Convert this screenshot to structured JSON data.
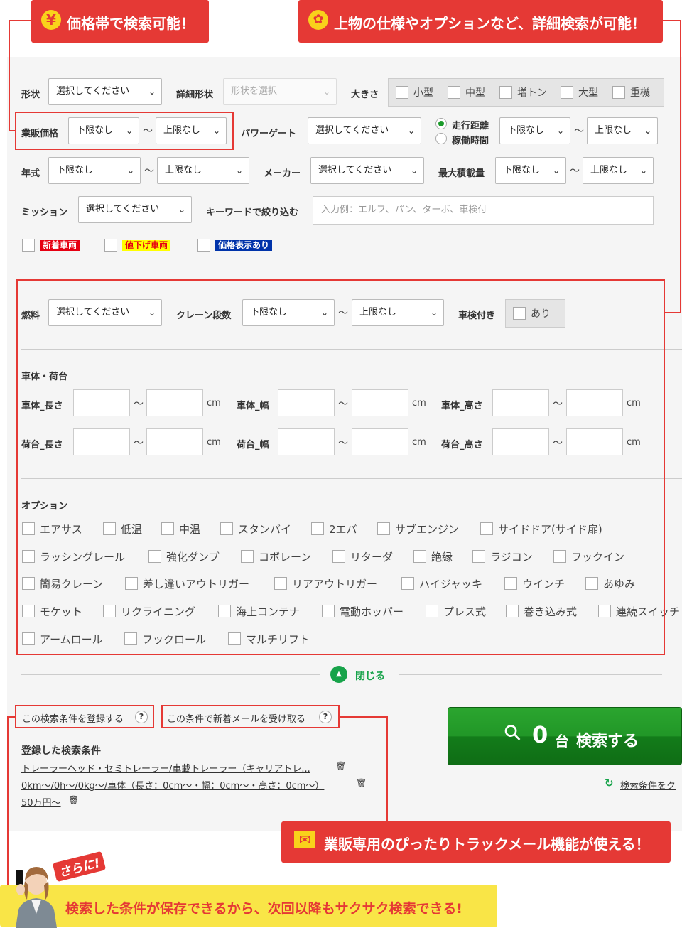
{
  "callouts": {
    "price_search": "価格帯で検索可能！",
    "detail_search": "上物の仕様やオプションなど、詳細検索が可能！",
    "mail_feature": "業販専用のぴったりトラックメール機能が使える！",
    "save_feature": "検索した条件が保存できるから、次回以降もサクサク検索できる!",
    "more_label": "さらに!"
  },
  "icons": {
    "yen": "¥",
    "gear": "✿",
    "mail": "✉",
    "search": "⚲",
    "trash": "🗑",
    "help": "?",
    "reset": "↻",
    "up": "▲"
  },
  "form": {
    "shape_label": "形状",
    "shape_value": "選択してください",
    "detail_shape_label": "詳細形状",
    "detail_shape_placeholder": "形状を選択",
    "size_label": "大きさ",
    "sizes": [
      "小型",
      "中型",
      "増トン",
      "大型",
      "重機"
    ],
    "price_label": "業販価格",
    "price_min": "下限なし",
    "price_max": "上限なし",
    "tilde": "〜",
    "powergate_label": "パワーゲート",
    "powergate_value": "選択してください",
    "radio_mileage": "走行距離",
    "radio_hours": "稼働時間",
    "mileage_min": "下限なし",
    "mileage_max": "上限なし",
    "year_label": "年式",
    "year_min": "下限なし",
    "year_max": "上限なし",
    "maker_label": "メーカー",
    "maker_value": "選択してください",
    "load_label": "最大積載量",
    "load_min": "下限なし",
    "load_max": "上限なし",
    "mission_label": "ミッション",
    "mission_value": "選択してください",
    "keyword_label": "キーワードで絞り込む",
    "keyword_placeholder": "入力例：エルフ、パン、ターボ、車検付",
    "flags": [
      "新着車両",
      "値下げ車両",
      "価格表示あり"
    ]
  },
  "detail": {
    "fuel_label": "燃料",
    "fuel_value": "選択してください",
    "crane_label": "クレーン段数",
    "crane_min": "下限なし",
    "crane_max": "上限なし",
    "inspection_label": "車検付き",
    "inspection_value": "あり",
    "body_heading": "車体・荷台",
    "body_length": "車体_長さ",
    "body_width": "車体_幅",
    "body_height": "車体_高さ",
    "bed_length": "荷台_長さ",
    "bed_width": "荷台_幅",
    "bed_height": "荷台_高さ",
    "unit": "cm",
    "options_heading": "オプション",
    "options_row1": [
      "エアサス",
      "低温",
      "中温",
      "スタンバイ",
      "2エバ",
      "サブエンジン",
      "サイドドア(サイド扉)"
    ],
    "options_row2": [
      "ラッシングレール",
      "強化ダンプ",
      "コボレーン",
      "リターダ",
      "絶縁",
      "ラジコン",
      "フックイン"
    ],
    "options_row3": [
      "簡易クレーン",
      "差し違いアウトリガー",
      "リアアウトリガー",
      "ハイジャッキ",
      "ウインチ",
      "あゆみ"
    ],
    "options_row4": [
      "モケット",
      "リクライニング",
      "海上コンテナ",
      "電動ホッパー",
      "プレス式",
      "巻き込み式",
      "連続スイッチ"
    ],
    "options_row5": [
      "アームロール",
      "フックロール",
      "マルチリフト"
    ],
    "close_label": "閉じる"
  },
  "actions": {
    "save_condition": "この検索条件を登録する",
    "receive_mail": "この条件で新着メールを受け取る",
    "search_count": "0",
    "search_unit": "台",
    "search_label": "検索する",
    "clear_label": "検索条件をク",
    "saved_heading": "登録した検索条件",
    "saved_items": [
      "トレーラーヘッド・セミトレーラー/車載トレーラー（キャリアトレ...",
      "0km〜/0h〜/0kg〜/車体（長さ：0cm〜・幅：0cm〜・高さ：0cm〜）",
      "50万円〜"
    ]
  },
  "colors": {
    "accent_red": "#e53935",
    "callout_yellow": "#f9e547",
    "search_green": "#1a8a22",
    "close_green": "#17a34a",
    "badge_new": "#e60012",
    "badge_down": "#ffff00",
    "badge_price": "#0033aa"
  }
}
